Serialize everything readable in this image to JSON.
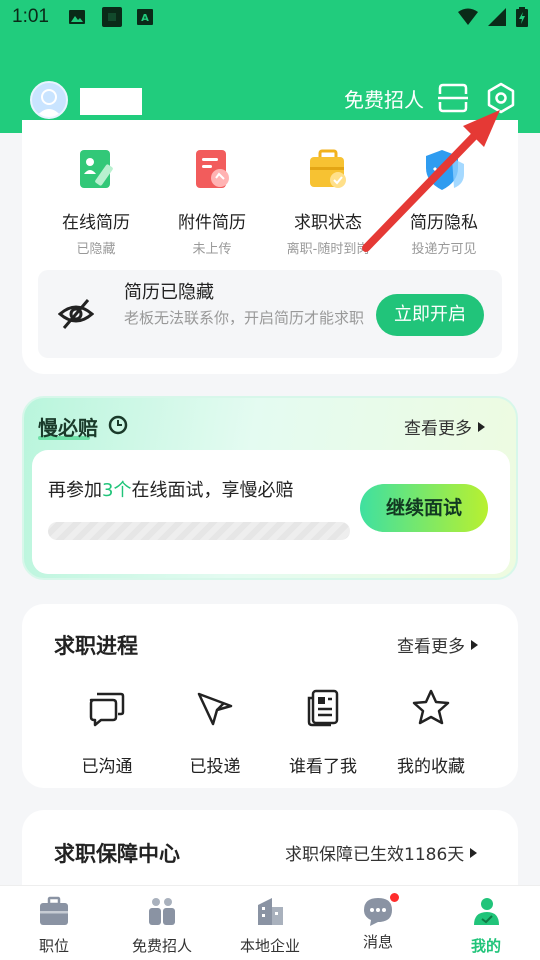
{
  "status_bar": {
    "time": "1:01"
  },
  "header": {
    "recruit_label": "免费招人"
  },
  "resume_actions": [
    {
      "label": "在线简历",
      "sub": "已隐藏"
    },
    {
      "label": "附件简历",
      "sub": "未上传"
    },
    {
      "label": "求职状态",
      "sub": "离职-随时到岗"
    },
    {
      "label": "简历隐私",
      "sub": "投递方可见"
    }
  ],
  "hidden_notice": {
    "title": "简历已隐藏",
    "desc": "老板无法联系你，开启简历才能求职",
    "button": "立即开启"
  },
  "guarantee": {
    "title": "慢必赔",
    "more": "查看更多",
    "text_pre": "再参加",
    "text_count": "3个",
    "text_post": "在线面试，享慢必赔",
    "button": "继续面试"
  },
  "progress": {
    "title": "求职进程",
    "more": "查看更多",
    "items": [
      {
        "label": "已沟通"
      },
      {
        "label": "已投递"
      },
      {
        "label": "谁看了我"
      },
      {
        "label": "我的收藏"
      }
    ]
  },
  "safety": {
    "title": "求职保障中心",
    "status": "求职保障已生效1186天"
  },
  "tabs": [
    {
      "label": "职位"
    },
    {
      "label": "免费招人"
    },
    {
      "label": "本地企业"
    },
    {
      "label": "消息"
    },
    {
      "label": "我的"
    }
  ],
  "colors": {
    "brand": "#21cc7d",
    "accent": "#21c47a",
    "arrow": "#e53935",
    "badge": "#ff2d2d"
  }
}
